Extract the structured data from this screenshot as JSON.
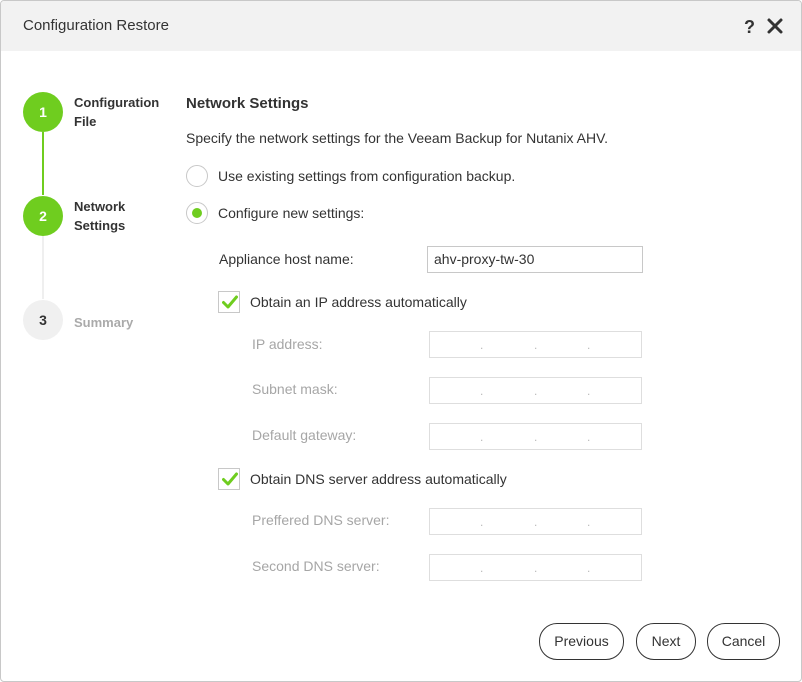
{
  "window": {
    "title": "Configuration Restore",
    "help_glyph": "?"
  },
  "steps": [
    {
      "number": "1",
      "label_line1": "Configuration",
      "label_line2": "File"
    },
    {
      "number": "2",
      "label_line1": "Network",
      "label_line2": "Settings"
    },
    {
      "number": "3",
      "label_line1": "Summary"
    }
  ],
  "main": {
    "heading": "Network Settings",
    "description": "Specify the network settings for the Veeam Backup for Nutanix AHV.",
    "options": {
      "existing": "Use existing settings from configuration backup.",
      "configure_new": "Configure new settings:"
    },
    "host_name_label": "Appliance host name:",
    "host_name_value": "ahv-proxy-tw-30",
    "obtain_ip_label": "Obtain an IP address automatically",
    "ip_address_label": "IP address:",
    "subnet_mask_label": "Subnet mask:",
    "gateway_label": "Default gateway:",
    "obtain_dns_label": "Obtain DNS server address automatically",
    "preferred_dns_label": "Preffered DNS server:",
    "second_dns_label": "Second DNS server:"
  },
  "buttons": {
    "previous": "Previous",
    "next": "Next",
    "cancel": "Cancel"
  },
  "colors": {
    "accent": "#6fcd1f",
    "titlebar": "#f2f2f2",
    "disabled_text": "#a6a6a6"
  }
}
